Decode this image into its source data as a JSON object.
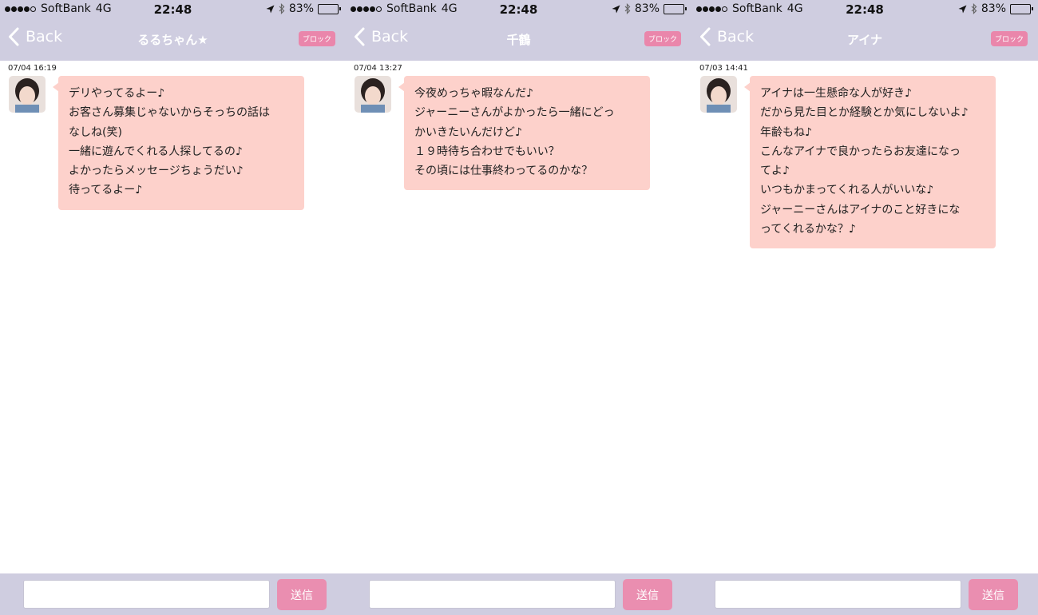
{
  "panels": [
    {
      "status": {
        "carrier": "SoftBank",
        "network": "4G",
        "time": "22:48",
        "battery": "83%"
      },
      "nav": {
        "back_label": "Back",
        "title": "るるちゃん★",
        "block_label": "ブロック"
      },
      "message": {
        "timestamp": "07/04 16:19",
        "lines": [
          "デリやってるよー♪",
          "お客さん募集じゃないからそっちの話は",
          "なしね(笑)",
          "一緒に遊んでくれる人探してるの♪",
          "よかったらメッセージちょうだい♪",
          "待ってるよー♪"
        ]
      },
      "compose": {
        "value": "",
        "send_label": "送信"
      }
    },
    {
      "status": {
        "carrier": "SoftBank",
        "network": "4G",
        "time": "22:48",
        "battery": "83%"
      },
      "nav": {
        "back_label": "Back",
        "title": "千鶴",
        "block_label": "ブロック"
      },
      "message": {
        "timestamp": "07/04 13:27",
        "lines": [
          "今夜めっちゃ暇なんだ♪",
          "ジャーニーさんがよかったら一緒にどっ",
          "かいきたいんだけど♪",
          "１９時待ち合わせでもいい？",
          "その頃には仕事終わってるのかな？"
        ]
      },
      "compose": {
        "value": "",
        "send_label": "送信"
      }
    },
    {
      "status": {
        "carrier": "SoftBank",
        "network": "4G",
        "time": "22:48",
        "battery": "83%"
      },
      "nav": {
        "back_label": "Back",
        "title": "アイナ",
        "block_label": "ブロック"
      },
      "message": {
        "timestamp": "07/03 14:41",
        "lines": [
          "アイナは一生懸命な人が好き♪",
          "だから見た目とか経験とか気にしないよ♪",
          "年齢もね♪",
          "こんなアイナで良かったらお友達になっ",
          "てよ♪",
          "いつもかまってくれる人がいいな♪",
          "ジャーニーさんはアイナのこと好きにな",
          "ってくれるかな？♪"
        ]
      },
      "compose": {
        "value": "",
        "send_label": "送信"
      }
    }
  ],
  "colors": {
    "header_bg": "#cfcde0",
    "bubble_bg": "#fdd1cb",
    "accent_pink": "#ea86ab",
    "text": "#222222"
  },
  "icons": {
    "back": "chevron-left-icon",
    "location": "location-arrow-icon",
    "bluetooth": "bluetooth-icon",
    "battery": "battery-icon"
  },
  "battery_level": 0.83
}
